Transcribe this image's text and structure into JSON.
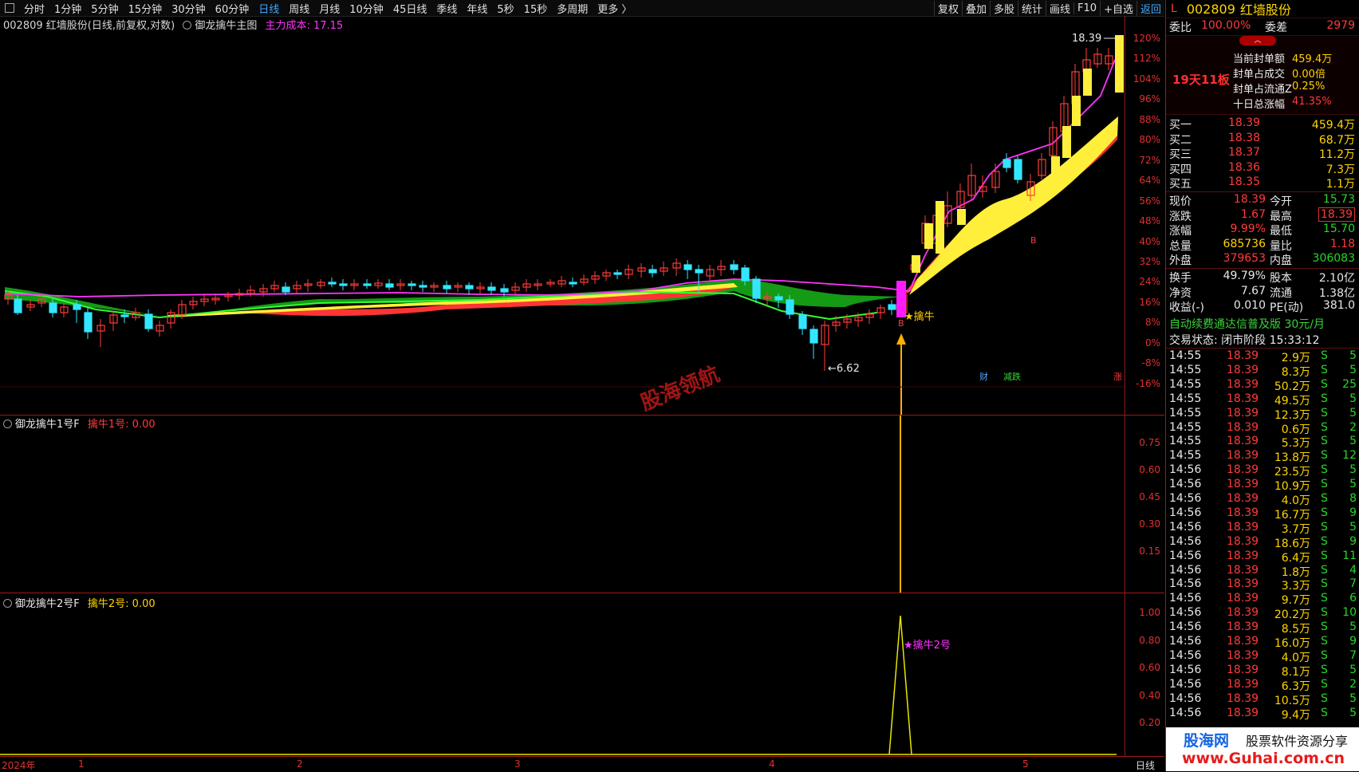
{
  "topbar": {
    "periods": [
      "分时",
      "1分钟",
      "5分钟",
      "15分钟",
      "30分钟",
      "60分钟",
      "日线",
      "周线",
      "月线",
      "10分钟",
      "45日线",
      "季线",
      "年线",
      "5秒",
      "15秒",
      "多周期",
      "更多 〉"
    ],
    "active_period": "日线",
    "tools": [
      "复权",
      "叠加",
      "多股",
      "统计",
      "画线",
      "F10",
      "+自选",
      "返回"
    ]
  },
  "main_panel": {
    "stock": "002809 红墙股份(日线,前复权,对数)",
    "indicator": "御龙擒牛主图",
    "cost_label": "主力成本: 17.15",
    "y_ticks": [
      "120%",
      "112%",
      "104%",
      "96%",
      "88%",
      "80%",
      "72%",
      "64%",
      "56%",
      "48%",
      "40%",
      "32%",
      "24%",
      "16%",
      "8%",
      "0%",
      "-8%",
      "-16%"
    ],
    "high_label": "18.39",
    "low_label": "←6.62",
    "signal_label": "★擒牛",
    "b_marker": "B",
    "watermark": "股海领航",
    "markers": [
      "财",
      "减跌",
      "涨"
    ]
  },
  "sub1": {
    "name": "御龙擒牛1号F",
    "value": "擒牛1号: 0.00",
    "y_ticks": [
      "0.75",
      "0.60",
      "0.45",
      "0.30",
      "0.15"
    ]
  },
  "sub2": {
    "name": "御龙擒牛2号F",
    "value": "擒牛2号: 0.00",
    "y_ticks": [
      "1.00",
      "0.80",
      "0.60",
      "0.40",
      "0.20"
    ],
    "signal_label": "★擒牛2号"
  },
  "xaxis": {
    "labels": [
      "2024年",
      "1",
      "2",
      "3",
      "4",
      "5"
    ],
    "period": "日线"
  },
  "right_panel": {
    "flag": "L",
    "code": "002809",
    "name": "红墙股份",
    "weibi_label": "委比",
    "weibi": "100.00%",
    "weicha_label": "委差",
    "weicha": "2979",
    "board": "19天11板",
    "seal": [
      {
        "k": "当前封单额",
        "v": "459.4万"
      },
      {
        "k": "封单占成交",
        "v": "0.00倍"
      },
      {
        "k": "封单占流通Z",
        "v": "0.25%"
      },
      {
        "k": "十日总涨幅",
        "v": "41.35%"
      }
    ],
    "bids": [
      {
        "l": "买一",
        "p": "18.39",
        "v": "459.4万"
      },
      {
        "l": "买二",
        "p": "18.38",
        "v": "68.7万"
      },
      {
        "l": "买三",
        "p": "18.37",
        "v": "11.2万"
      },
      {
        "l": "买四",
        "p": "18.36",
        "v": "7.3万"
      },
      {
        "l": "买五",
        "p": "18.35",
        "v": "1.1万"
      }
    ],
    "quote": [
      {
        "a": "现价",
        "b": "18.39",
        "c": "今开",
        "d": "15.73"
      },
      {
        "a": "涨跌",
        "b": "1.67",
        "c": "最高",
        "d": "18.39"
      },
      {
        "a": "涨幅",
        "b": "9.99%",
        "c": "最低",
        "d": "15.70"
      },
      {
        "a": "总量",
        "b": "685736",
        "c": "量比",
        "d": "1.18"
      },
      {
        "a": "外盘",
        "b": "379653",
        "c": "内盘",
        "d": "306083"
      }
    ],
    "info": [
      {
        "a": "换手",
        "b": "49.79%",
        "c": "股本",
        "d": "2.10亿"
      },
      {
        "a": "净资",
        "b": "7.67",
        "c": "流通",
        "d": "1.38亿"
      },
      {
        "a": "收益(-)",
        "b": "0.010",
        "c": "PE(动)",
        "d": "381.0"
      }
    ],
    "promo": "自动续费通达信普及版 30元/月",
    "trade_status": "交易状态: 闭市阶段 15:33:12",
    "ticks": [
      {
        "t": "14:55",
        "p": "18.39",
        "v": "2.9万",
        "s": "S",
        "n": "5"
      },
      {
        "t": "14:55",
        "p": "18.39",
        "v": "8.3万",
        "s": "S",
        "n": "5"
      },
      {
        "t": "14:55",
        "p": "18.39",
        "v": "50.2万",
        "s": "S",
        "n": "25"
      },
      {
        "t": "14:55",
        "p": "18.39",
        "v": "49.5万",
        "s": "S",
        "n": "5"
      },
      {
        "t": "14:55",
        "p": "18.39",
        "v": "12.3万",
        "s": "S",
        "n": "5"
      },
      {
        "t": "14:55",
        "p": "18.39",
        "v": "0.6万",
        "s": "S",
        "n": "2"
      },
      {
        "t": "14:55",
        "p": "18.39",
        "v": "5.3万",
        "s": "S",
        "n": "5"
      },
      {
        "t": "14:55",
        "p": "18.39",
        "v": "13.8万",
        "s": "S",
        "n": "12"
      },
      {
        "t": "14:56",
        "p": "18.39",
        "v": "23.5万",
        "s": "S",
        "n": "5"
      },
      {
        "t": "14:56",
        "p": "18.39",
        "v": "10.9万",
        "s": "S",
        "n": "5"
      },
      {
        "t": "14:56",
        "p": "18.39",
        "v": "4.0万",
        "s": "S",
        "n": "8"
      },
      {
        "t": "14:56",
        "p": "18.39",
        "v": "16.7万",
        "s": "S",
        "n": "9"
      },
      {
        "t": "14:56",
        "p": "18.39",
        "v": "3.7万",
        "s": "S",
        "n": "5"
      },
      {
        "t": "14:56",
        "p": "18.39",
        "v": "18.6万",
        "s": "S",
        "n": "9"
      },
      {
        "t": "14:56",
        "p": "18.39",
        "v": "6.4万",
        "s": "S",
        "n": "11"
      },
      {
        "t": "14:56",
        "p": "18.39",
        "v": "1.8万",
        "s": "S",
        "n": "4"
      },
      {
        "t": "14:56",
        "p": "18.39",
        "v": "3.3万",
        "s": "S",
        "n": "7"
      },
      {
        "t": "14:56",
        "p": "18.39",
        "v": "9.7万",
        "s": "S",
        "n": "6"
      },
      {
        "t": "14:56",
        "p": "18.39",
        "v": "20.2万",
        "s": "S",
        "n": "10"
      },
      {
        "t": "14:56",
        "p": "18.39",
        "v": "8.5万",
        "s": "S",
        "n": "5"
      },
      {
        "t": "14:56",
        "p": "18.39",
        "v": "16.0万",
        "s": "S",
        "n": "9"
      },
      {
        "t": "14:56",
        "p": "18.39",
        "v": "4.0万",
        "s": "S",
        "n": "7"
      },
      {
        "t": "14:56",
        "p": "18.39",
        "v": "8.1万",
        "s": "S",
        "n": "5"
      },
      {
        "t": "14:56",
        "p": "18.39",
        "v": "6.3万",
        "s": "S",
        "n": "2"
      },
      {
        "t": "14:56",
        "p": "18.39",
        "v": "10.5万",
        "s": "S",
        "n": "5"
      },
      {
        "t": "14:56",
        "p": "18.39",
        "v": "9.4万",
        "s": "S",
        "n": "5"
      }
    ],
    "footer_logo": "股海网",
    "footer_slogan": "股票软件资源分享",
    "footer_url": "www.Guhai.com.cn"
  },
  "colors": {
    "up": "#ff3b3b",
    "down": "#33e6ff",
    "ma5": "#ff34ff",
    "band_yellow": "#ffef3a",
    "band_red": "#ff3535",
    "band_green": "#159a15"
  }
}
